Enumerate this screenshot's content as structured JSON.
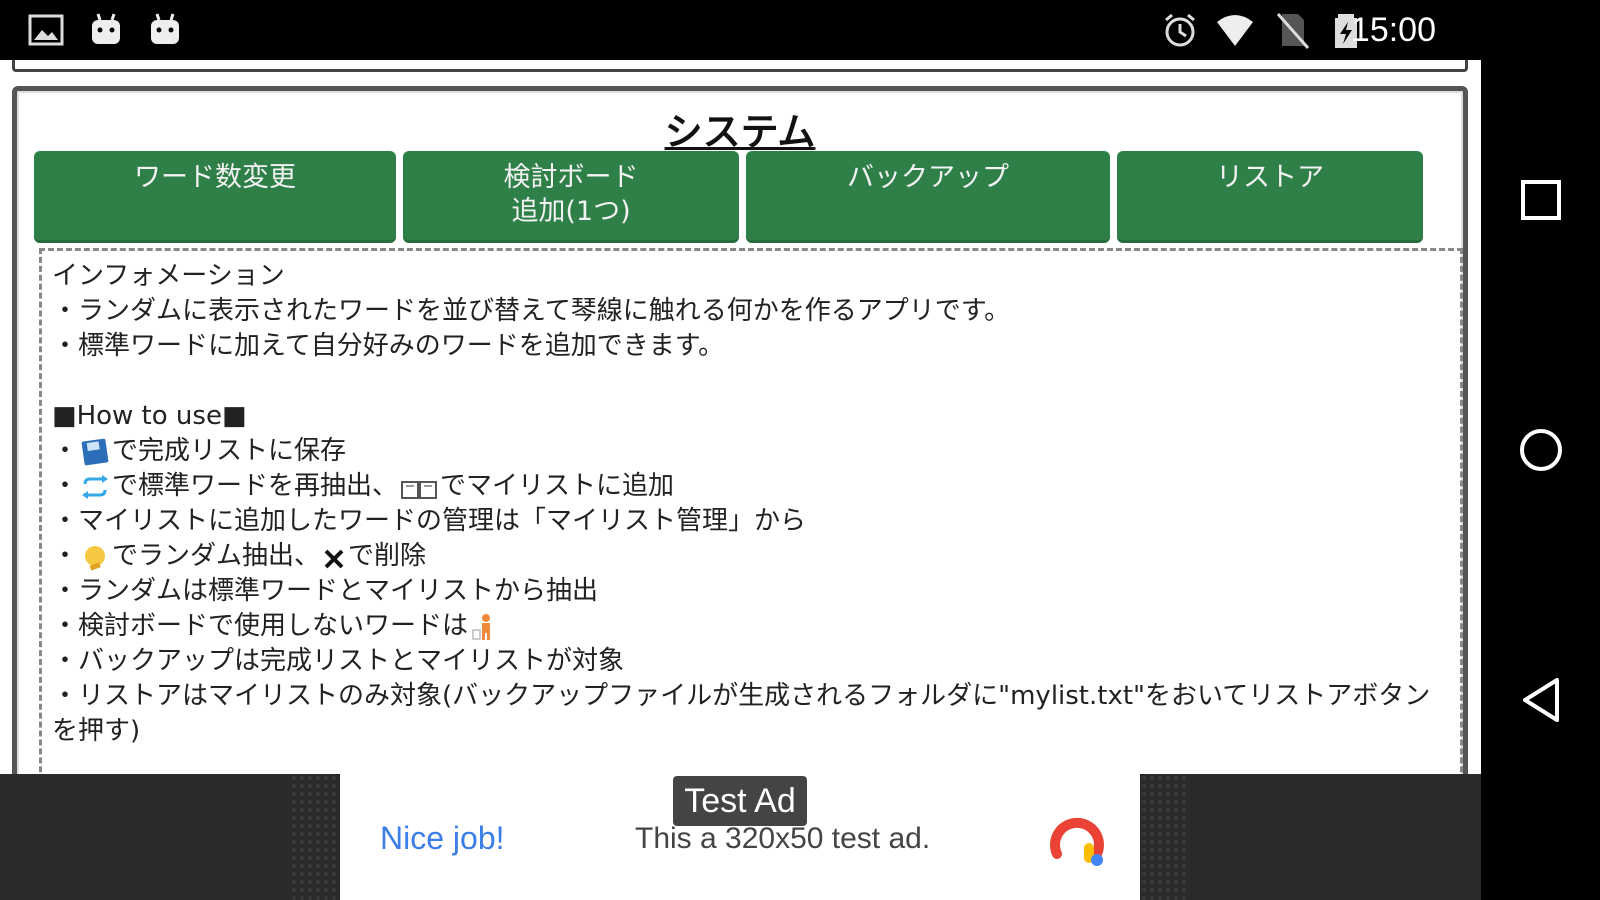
{
  "status_bar": {
    "time": "15:00",
    "icons": [
      "image-icon",
      "android-icon",
      "android-icon",
      "alarm-icon",
      "wifi-icon",
      "no-sim-icon",
      "battery-charging-icon"
    ]
  },
  "panel": {
    "title": "システム",
    "buttons": [
      {
        "label": "ワード数変更"
      },
      {
        "label": "検討ボード\n追加(1つ)"
      },
      {
        "label": "バックアップ"
      },
      {
        "label": "リストア"
      }
    ],
    "info": {
      "heading": "インフォメーション",
      "intro": [
        "・ランダムに表示されたワードを並び替えて琴線に触れる何かを作るアプリです。",
        "・標準ワードに加えて自分好みのワードを追加できます。"
      ],
      "howto_heading": "■How to use■",
      "howto": {
        "save_prefix": "・",
        "save_suffix": "で完成リストに保存",
        "reroll_prefix": "・",
        "reroll_mid": "で標準ワードを再抽出、",
        "reroll_suffix": "でマイリストに追加",
        "mylist_manage": "・マイリストに追加したワードの管理は「マイリスト管理」から",
        "random_prefix": "・",
        "random_mid": "でランダム抽出、",
        "random_suffix": "で削除",
        "random_source": "・ランダムは標準ワードとマイリストから抽出",
        "unused_prefix": "・検討ボードで使用しないワードは",
        "backup_target": "・バックアップは完成リストとマイリストが対象",
        "restore_target": "・リストアはマイリストのみ対象(バックアップファイルが生成されるフォルダに\"mylist.txt\"をおいてリストアボタンを押す)"
      }
    }
  },
  "ad": {
    "label": "Test Ad",
    "headline": "Nice job!",
    "description": "This a 320x50 test ad."
  },
  "colors": {
    "button_green": "#2f8048",
    "ad_blue": "#3b7ee8"
  }
}
